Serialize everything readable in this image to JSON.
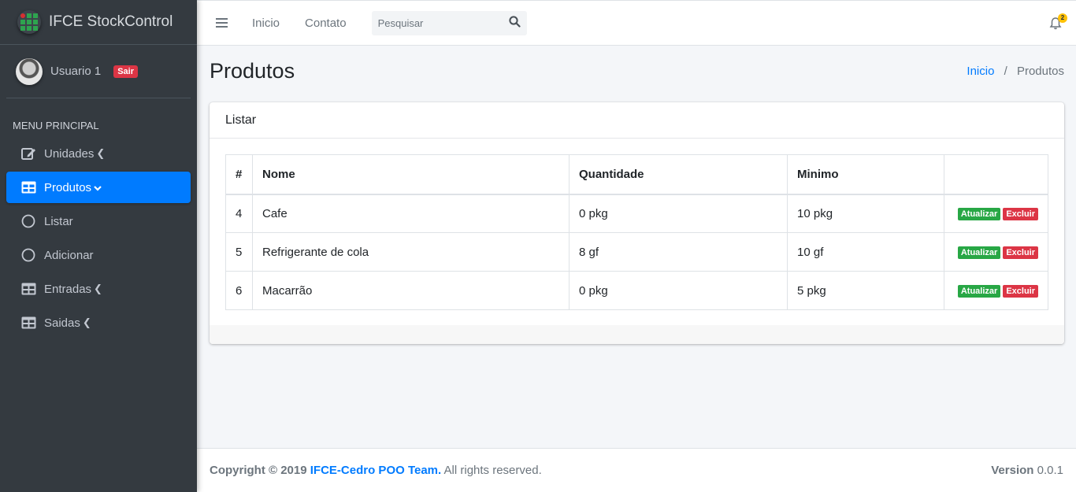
{
  "brand": {
    "title": "IFCE StockControl"
  },
  "user": {
    "name": "Usuario 1",
    "logout_label": "Sair"
  },
  "menu": {
    "header": "MENU PRINCIPAL",
    "items": [
      {
        "label": "Unidades",
        "icon": "edit-icon",
        "chevron": "‹"
      },
      {
        "label": "Produtos",
        "icon": "table-icon",
        "chevron": "⌄",
        "active": true
      },
      {
        "label": "Listar",
        "icon": "circle-icon"
      },
      {
        "label": "Adicionar",
        "icon": "circle-icon"
      },
      {
        "label": "Entradas",
        "icon": "table-icon",
        "chevron": "‹"
      },
      {
        "label": "Saidas",
        "icon": "table-icon",
        "chevron": "‹"
      }
    ]
  },
  "topbar": {
    "links": [
      "Inicio",
      "Contato"
    ],
    "search_placeholder": "Pesquisar",
    "notifications_count": "2"
  },
  "page": {
    "title": "Produtos",
    "breadcrumb": {
      "home": "Inicio",
      "separator": "/",
      "current": "Produtos"
    }
  },
  "card": {
    "title": "Listar",
    "table": {
      "headers": [
        "#",
        "Nome",
        "Quantidade",
        "Minimo",
        ""
      ],
      "rows": [
        {
          "id": "4",
          "nome": "Cafe",
          "quantidade": "0 pkg",
          "minimo": "10 pkg"
        },
        {
          "id": "5",
          "nome": "Refrigerante de cola",
          "quantidade": "8 gf",
          "minimo": "10 gf"
        },
        {
          "id": "6",
          "nome": "Macarrão",
          "quantidade": "0 pkg",
          "minimo": "5 pkg"
        }
      ],
      "update_label": "Atualizar",
      "delete_label": "Excluir"
    }
  },
  "footer": {
    "copyright": "Copyright © 2019",
    "team": "IFCE-Cedro POO Team.",
    "rights": "All rights reserved.",
    "version_label": "Version",
    "version": "0.0.1"
  },
  "colors": {
    "primary": "#007bff",
    "success": "#28a745",
    "danger": "#dc3545",
    "sidebar": "#343a40",
    "warning": "#ffc107"
  }
}
